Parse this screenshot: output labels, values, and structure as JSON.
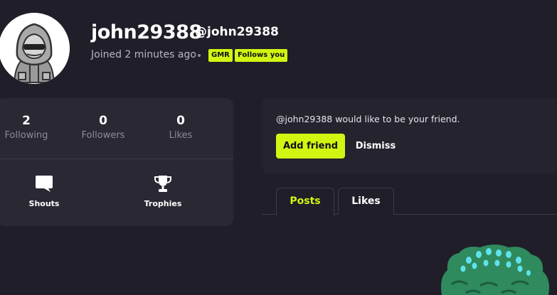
{
  "profile": {
    "display_name": "john29388",
    "handle": "@john29388",
    "joined": "Joined 2 minutes ago",
    "badges": [
      "GMR",
      "Follows you"
    ]
  },
  "stats": [
    {
      "value": "2",
      "label": "Following"
    },
    {
      "value": "0",
      "label": "Followers"
    },
    {
      "value": "0",
      "label": "Likes"
    }
  ],
  "actions": [
    {
      "label": "Shouts",
      "icon": "speech-bubble-icon"
    },
    {
      "label": "Trophies",
      "icon": "trophy-icon"
    }
  ],
  "friend_request": {
    "message": "@john29388 would like to be your friend.",
    "accept_label": "Add friend",
    "dismiss_label": "Dismiss"
  },
  "tabs": [
    {
      "label": "Posts",
      "active": true
    },
    {
      "label": "Likes",
      "active": false
    }
  ],
  "colors": {
    "background": "#201e28",
    "card": "#2a2833",
    "accent": "#d2f512"
  }
}
